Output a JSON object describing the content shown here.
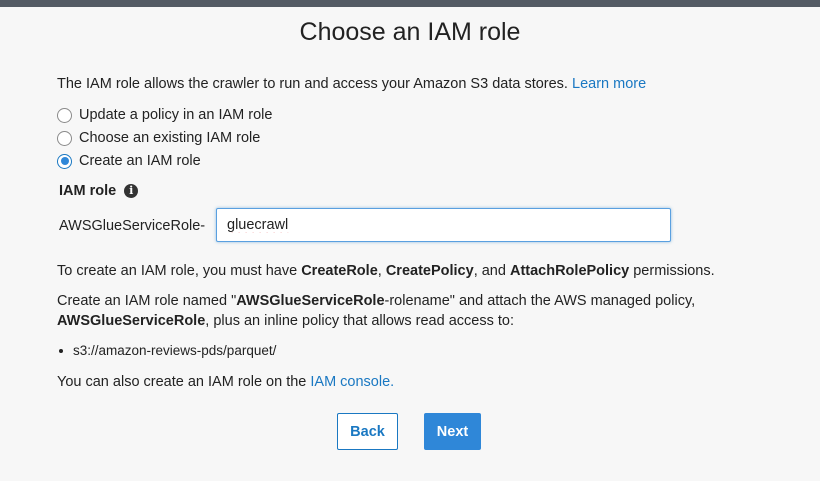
{
  "title": "Choose an IAM role",
  "intro": {
    "text": "The IAM role allows the crawler to run and access your Amazon S3 data stores.",
    "link": "Learn more"
  },
  "options": [
    {
      "label": "Update a policy in an IAM role",
      "selected": false
    },
    {
      "label": "Choose an existing IAM role",
      "selected": false
    },
    {
      "label": "Create an IAM role",
      "selected": true
    }
  ],
  "role_field": {
    "label": "IAM role",
    "prefix": "AWSGlueServiceRole-",
    "value": "gluecrawl"
  },
  "permissions": {
    "t1": "To create an IAM role, you must have ",
    "p1": "CreateRole",
    "t2": ", ",
    "p2": "CreatePolicy",
    "t3": ", and ",
    "p3": "AttachRolePolicy",
    "t4": " permissions."
  },
  "named_role": {
    "t1": "Create an IAM role named \"",
    "b1": "AWSGlueServiceRole",
    "t2": "-rolename\" and attach the AWS managed policy,",
    "b2": "AWSGlueServiceRole",
    "t3": ", plus an inline policy that allows read access to:"
  },
  "s3_path": "s3://amazon-reviews-pds/parquet/",
  "console_note": {
    "text": "You can also create an IAM role on the ",
    "link": "IAM console."
  },
  "buttons": {
    "back": "Back",
    "next": "Next"
  }
}
